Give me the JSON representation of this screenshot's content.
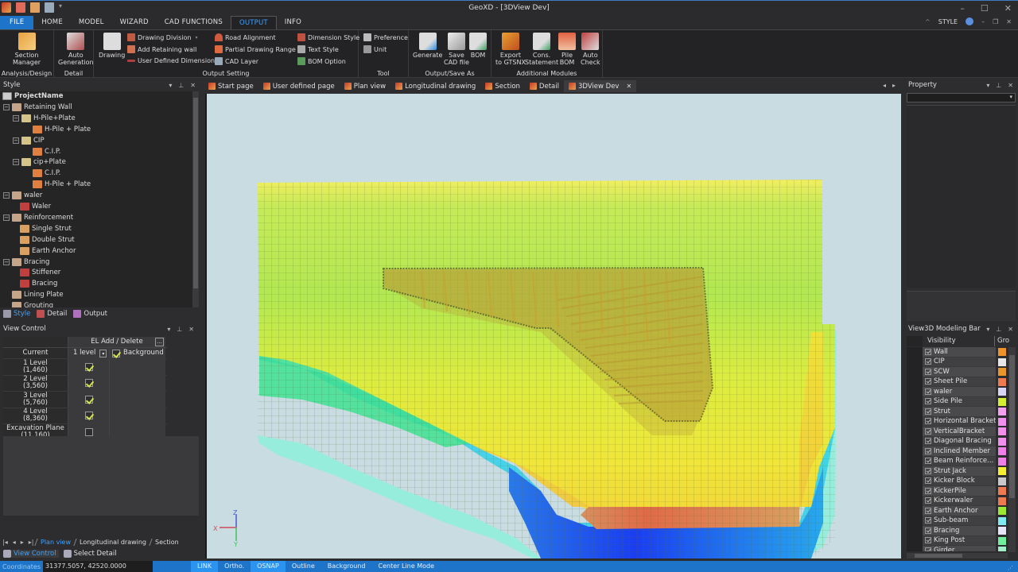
{
  "app": {
    "title": "GeoXD - [3DView Dev]",
    "window_buttons": [
      "–",
      "☐",
      "✕"
    ]
  },
  "menu": {
    "tabs": [
      "FILE",
      "HOME",
      "MODEL",
      "WIZARD",
      "CAD FUNCTIONS",
      "OUTPUT",
      "INFO"
    ],
    "active": "OUTPUT",
    "style_label": "STYLE"
  },
  "ribbon": {
    "groups": {
      "analysis": {
        "label": "Analysis/Design",
        "buttons": [
          {
            "label": "Section\nManager",
            "icon": "section-manager-icon"
          }
        ]
      },
      "detail": {
        "label": "Detail",
        "buttons": [
          {
            "label": "Auto\nGeneration",
            "icon": "auto-generation-icon"
          }
        ]
      },
      "output_setting": {
        "label": "Output Setting",
        "big": {
          "label": "Drawing",
          "icon": "drawing-icon"
        },
        "col1": [
          "Drawing Division",
          "Add Retaining wall",
          "User Defined Dimension"
        ],
        "col2": [
          "Road Alignment",
          "Partial Drawing Range",
          "CAD Layer"
        ],
        "col3": [
          "Dimension Style",
          "Text Style",
          "BOM Option"
        ]
      },
      "tool": {
        "label": "Tool",
        "items": [
          "Preference",
          "Unit"
        ]
      },
      "output_save": {
        "label": "Output/Save As",
        "buttons": [
          "Generate",
          "Save\nCAD file",
          "BOM"
        ]
      },
      "additional": {
        "label": "Additional Modules",
        "buttons": [
          "Export\nto GTSNX",
          "Cons.\nStatement",
          "Pile\nBOM",
          "Auto\nCheck"
        ]
      }
    }
  },
  "style_panel": {
    "title": "Style",
    "tree": [
      {
        "label": "ProjectName",
        "level": 0,
        "icon": "root"
      },
      {
        "label": "Retaining Wall",
        "level": 1,
        "icon": "folder",
        "exp": true
      },
      {
        "label": "H-Pile+Plate",
        "level": 2,
        "icon": "book",
        "exp": true
      },
      {
        "label": "H-Pile + Plate",
        "level": 3,
        "icon": "orange"
      },
      {
        "label": "CIP",
        "level": 2,
        "icon": "book",
        "exp": true
      },
      {
        "label": "C.I.P.",
        "level": 3,
        "icon": "orange"
      },
      {
        "label": "cip+Plate",
        "level": 2,
        "icon": "book",
        "exp": true
      },
      {
        "label": "C.I.P.",
        "level": 3,
        "icon": "orange"
      },
      {
        "label": "H-Pile + Plate",
        "level": 3,
        "icon": "orange"
      },
      {
        "label": "waler",
        "level": 1,
        "icon": "folder",
        "exp": true
      },
      {
        "label": "Waler",
        "level": 2,
        "icon": "red"
      },
      {
        "label": "Reinforcement",
        "level": 1,
        "icon": "folder",
        "exp": true
      },
      {
        "label": "Single Strut",
        "level": 2,
        "icon": "leaf"
      },
      {
        "label": "Double Strut",
        "level": 2,
        "icon": "leaf"
      },
      {
        "label": "Earth Anchor",
        "level": 2,
        "icon": "leaf"
      },
      {
        "label": "Bracing",
        "level": 1,
        "icon": "folder",
        "exp": true
      },
      {
        "label": "Stiffener",
        "level": 2,
        "icon": "red"
      },
      {
        "label": "Bracing",
        "level": 2,
        "icon": "red"
      },
      {
        "label": "Lining Plate",
        "level": 1,
        "icon": "folder"
      },
      {
        "label": "Grouting",
        "level": 1,
        "icon": "folder"
      }
    ],
    "bottom_tabs": [
      "Style",
      "Detail",
      "Output"
    ],
    "active_tab": "Style"
  },
  "view_control": {
    "title": "View Control",
    "header": "EL Add / Delete",
    "more_button": "...",
    "current_label": "Current",
    "level_select": "1 level",
    "background_label": "Background",
    "background_checked": true,
    "rows": [
      {
        "name": "1 Level",
        "el": "(1,460)",
        "checked": true
      },
      {
        "name": "2 Level",
        "el": "(3,560)",
        "checked": true
      },
      {
        "name": "3 Level",
        "el": "(5,760)",
        "checked": true
      },
      {
        "name": "4 Level",
        "el": "(8,360)",
        "checked": true
      },
      {
        "name": "Excavation Plane",
        "el": "(11,160)",
        "checked": false
      }
    ],
    "sheet_nav": [
      "|◂",
      "◂",
      "▸",
      "▸|"
    ],
    "sheets": [
      "Plan view",
      "Longitudinal drawing",
      "Section"
    ],
    "active_sheet": "Plan view",
    "footer_tabs": [
      "View Control",
      "Select Detail"
    ],
    "active_footer": "View Control"
  },
  "doc_tabs": {
    "tabs": [
      "Start page",
      "User defined page",
      "Plan view",
      "Longitudinal drawing",
      "Section",
      "Detail",
      "3DView Dev"
    ],
    "active": "3DView Dev",
    "close": "✕"
  },
  "viewport": {
    "axis": {
      "x": "X",
      "y": "Y",
      "z": "Z"
    },
    "colors": {
      "background": "#c8dce2",
      "top": "#f0ea60",
      "upper": "#b8e855",
      "mid": "#ecec3a",
      "lower": "#f2d63a",
      "hot": "#e07a4a",
      "blue": "#1a4ef0",
      "cyan": "#30d0e8",
      "green": "#40e090",
      "pale": "#90eedc",
      "wall": "#b8a038"
    }
  },
  "property_panel": {
    "title": "Property"
  },
  "modeling_bar": {
    "title": "View3D Modeling Bar",
    "col_visibility": "Visibility",
    "col_group": "Gro",
    "items": [
      {
        "label": "Wall",
        "color": "#f0922a"
      },
      {
        "label": "CIP",
        "color": "#e6e6e6"
      },
      {
        "label": "SCW",
        "color": "#e8962a"
      },
      {
        "label": "Sheet Pile",
        "color": "#f07a50"
      },
      {
        "label": "waler",
        "color": "#d8d4f4"
      },
      {
        "label": "Side Pile",
        "color": "#d4ee30"
      },
      {
        "label": "Strut",
        "color": "#f4a0f0"
      },
      {
        "label": "Horizontal Bracket",
        "color": "#f090ec"
      },
      {
        "label": "VerticalBracket",
        "color": "#f090ec"
      },
      {
        "label": "Diagonal Bracing",
        "color": "#f090ec"
      },
      {
        "label": "Inclined Member",
        "color": "#f080e8"
      },
      {
        "label": "Beam Reinforce...",
        "color": "#f080e8"
      },
      {
        "label": "Strut Jack",
        "color": "#f4f030"
      },
      {
        "label": "Kicker Block",
        "color": "#c8c8c8"
      },
      {
        "label": "KickerPile",
        "color": "#f07a50"
      },
      {
        "label": "Kickerwaler",
        "color": "#f07a50"
      },
      {
        "label": "Earth Anchor",
        "color": "#9cea30"
      },
      {
        "label": "Sub-beam",
        "color": "#80eaf0"
      },
      {
        "label": "Bracing",
        "color": "#e8e4f8"
      },
      {
        "label": "King Post",
        "color": "#70ee9c"
      },
      {
        "label": "Girder",
        "color": "#a0eec8"
      }
    ]
  },
  "status": {
    "coord_label": "Coordinates",
    "coord_value": "31377.5057, 42520.0000",
    "buttons": [
      {
        "label": "LINK",
        "on": true
      },
      {
        "label": "Ortho.",
        "on": false
      },
      {
        "label": "OSNAP",
        "on": true
      },
      {
        "label": "Outline",
        "on": false
      },
      {
        "label": "Background",
        "on": false
      },
      {
        "label": "Center Line Mode",
        "on": false
      }
    ]
  }
}
